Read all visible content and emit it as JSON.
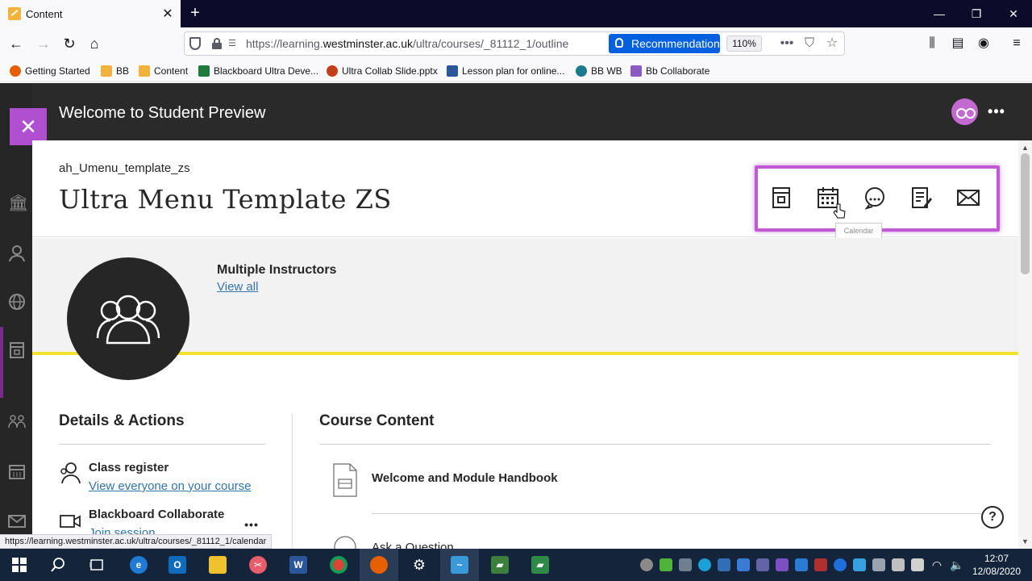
{
  "browser": {
    "tab_title": "Content",
    "url_prefix": "https://learning.",
    "url_domain": "westminster.ac.uk",
    "url_path": "/ultra/courses/_81112_1/outline",
    "recommendation_label": "Recommendation",
    "zoom": "110%",
    "bookmarks": [
      "Getting Started",
      "BB",
      "Content",
      "Blackboard Ultra Deve...",
      "Ultra Collab Slide.pptx",
      "Lesson plan for online...",
      "BB WB",
      "Bb Collaborate"
    ],
    "status_url": "https://learning.westminster.ac.uk/ultra/courses/_81112_1/calendar"
  },
  "preview": {
    "title": "Welcome to Student Preview"
  },
  "course": {
    "id": "ah_Umenu_template_zs",
    "name": "Ultra Menu Template ZS",
    "tools_tooltip": "Calendar"
  },
  "instructors": {
    "label": "Multiple Instructors",
    "view_all": "View all"
  },
  "details": {
    "title": "Details & Actions",
    "items": [
      {
        "title": "Class register",
        "link": "View everyone on your course"
      },
      {
        "title": "Blackboard Collaborate",
        "link": "Join session"
      }
    ]
  },
  "content": {
    "title": "Course Content",
    "items": [
      {
        "title": "Welcome and Module Handbook"
      },
      {
        "title": "Ask a Question"
      }
    ]
  },
  "taskbar": {
    "time": "12:07",
    "date": "12/08/2020"
  },
  "colors": {
    "accent_purple": "#c05ad3",
    "banner_yellow": "#f2e22e",
    "link_blue": "#3474a8",
    "firefox_blue": "#0060df"
  }
}
